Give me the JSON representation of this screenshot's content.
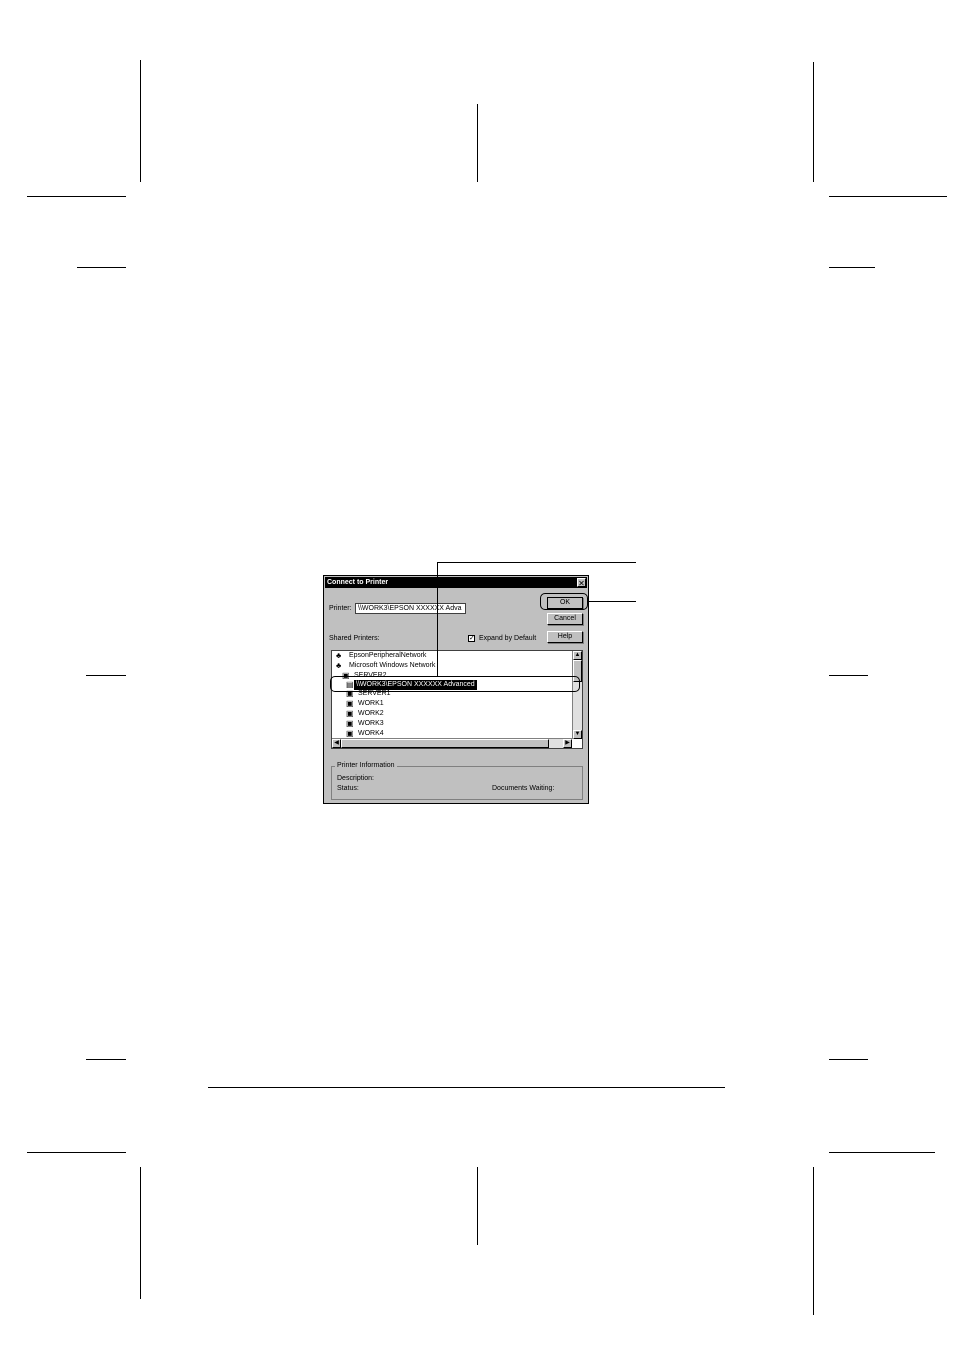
{
  "dialog": {
    "title": "Connect to Printer",
    "close_glyph": "✕",
    "printer_label": "Printer:",
    "printer_value": "\\\\WORK3\\EPSON XXXXXX Adva",
    "shared_printers_label": "Shared Printers:",
    "expand_label": "Expand by Default",
    "expand_checked": true,
    "buttons": {
      "ok": "OK",
      "cancel": "Cancel",
      "help": "Help"
    },
    "tree": [
      {
        "label": "EpsonPeripheralNetwork",
        "icon": "network-icon"
      },
      {
        "label": "Microsoft Windows Network",
        "icon": "network-icon"
      },
      {
        "label": "SERVER2",
        "icon": "computer-icon"
      },
      {
        "label": "\\\\WORK3\\EPSON XXXXXX Advanced",
        "icon": "printer-icon",
        "selected": true
      },
      {
        "label": "SERVER1",
        "icon": "computer-icon"
      },
      {
        "label": "WORK1",
        "icon": "computer-icon"
      },
      {
        "label": "WORK2",
        "icon": "computer-icon"
      },
      {
        "label": "WORK3",
        "icon": "computer-icon"
      },
      {
        "label": "WORK4",
        "icon": "computer-icon"
      }
    ],
    "info": {
      "group_label": "Printer Information",
      "description_label": "Description:",
      "status_label": "Status:",
      "documents_label": "Documents Waiting:"
    }
  }
}
